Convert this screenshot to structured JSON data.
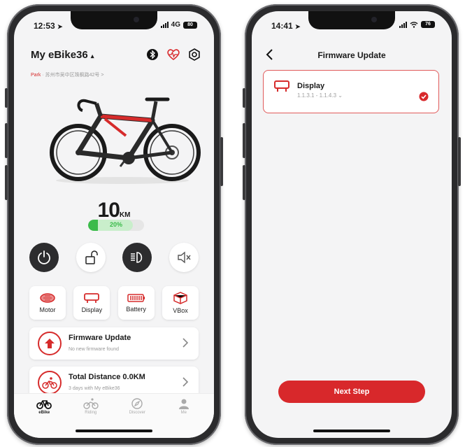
{
  "phone1": {
    "status": {
      "time": "12:53",
      "network": "4G",
      "battery": "80"
    },
    "header": {
      "title": "My eBike36",
      "icons": [
        "bluetooth-icon",
        "heart-rate-icon",
        "settings-gear-icon"
      ]
    },
    "location": {
      "tag": "Park",
      "address": "· 苏州市吴中区珠枫路42号 >"
    },
    "range": {
      "value": "10",
      "unit": "KM"
    },
    "battery": {
      "percent_label": "20%",
      "level": 0.2,
      "color": "#3bbb4a"
    },
    "controls": [
      {
        "name": "power",
        "icon": "power-icon"
      },
      {
        "name": "lock",
        "icon": "unlock-icon"
      },
      {
        "name": "headlight",
        "icon": "headlight-icon"
      },
      {
        "name": "mute",
        "icon": "speaker-mute-icon"
      }
    ],
    "tiles": [
      {
        "label": "Motor",
        "icon": "motor-icon"
      },
      {
        "label": "Display",
        "icon": "display-icon"
      },
      {
        "label": "Battery",
        "icon": "battery-icon"
      },
      {
        "label": "VBox",
        "icon": "vbox-icon"
      }
    ],
    "cards": [
      {
        "title": "Firmware Update",
        "subtitle": "No new firmware found",
        "icon": "upload-arrow-icon"
      },
      {
        "title": "Total Distance 0.0KM",
        "subtitle": "3 days with My eBike36",
        "icon": "cyclist-icon"
      }
    ],
    "tabs": [
      {
        "label": "eBike",
        "icon": "bike-icon",
        "active": true
      },
      {
        "label": "Riding",
        "icon": "rider-icon",
        "active": false
      },
      {
        "label": "Discover",
        "icon": "compass-icon",
        "active": false
      },
      {
        "label": "Me",
        "icon": "person-icon",
        "active": false
      }
    ]
  },
  "phone2": {
    "status": {
      "time": "14:41",
      "battery": "76"
    },
    "nav": {
      "title": "Firmware Update"
    },
    "item": {
      "name": "Display",
      "version": "1.1.3.1 - 1.1.4.3",
      "selected": true
    },
    "next_label": "Next Step"
  },
  "colors": {
    "accent": "#d8282b",
    "dark_button": "#2c2c2e",
    "background": "#f4f4f5"
  }
}
